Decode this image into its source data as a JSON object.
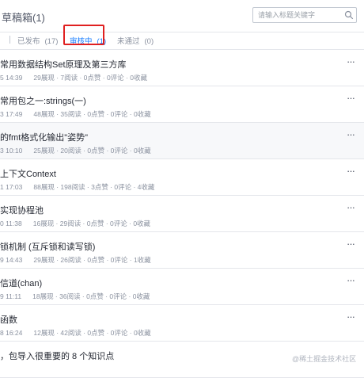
{
  "header": {
    "drafts_label": "草稿箱(1)",
    "search_placeholder": "请输入标题关键字"
  },
  "tabs": [
    {
      "label": "已发布",
      "count": "(17)",
      "active": false
    },
    {
      "label": "审核中",
      "count": "(1)",
      "active": true
    },
    {
      "label": "未通过",
      "count": "(0)",
      "active": false
    }
  ],
  "articles": [
    {
      "title": "常用数据结构Set原理及第三方库",
      "date": "5 14:39",
      "stats": "29展现 · 7阅读 · 0点赞 · 0评论 · 0收藏"
    },
    {
      "title": "常用包之一:strings(一)",
      "date": "3 17:49",
      "stats": "48展现 · 35阅读 · 0点赞 · 0评论 · 0收藏"
    },
    {
      "title": "的fmt格式化输出\"姿势\"",
      "date": "3 10:10",
      "stats": "25展现 · 20阅读 · 0点赞 · 0评论 · 0收藏"
    },
    {
      "title": "上下文Context",
      "date": "1 17:03",
      "stats": "88展现 · 198阅读 · 3点赞 · 0评论 · 4收藏"
    },
    {
      "title": "实现协程池",
      "date": "0 11:38",
      "stats": "16展现 · 29阅读 · 0点赞 · 0评论 · 0收藏"
    },
    {
      "title": "锁机制 (互斥锁和读写锁)",
      "date": "9 14:43",
      "stats": "29展现 · 26阅读 · 0点赞 · 0评论 · 1收藏"
    },
    {
      "title": "信道(chan)",
      "date": "9 11:11",
      "stats": "18展现 · 36阅读 · 0点赞 · 0评论 · 0收藏"
    },
    {
      "title": "函数",
      "date": "8 16:24",
      "stats": "12展现 · 42阅读 · 0点赞 · 0评论 · 0收藏"
    },
    {
      "title": "，包导入很重要的 8 个知识点",
      "date": "",
      "stats": ""
    }
  ],
  "more_label": "···",
  "watermark": "@稀土掘金技术社区",
  "icons": {
    "search": "search-icon",
    "more": "more-icon"
  }
}
